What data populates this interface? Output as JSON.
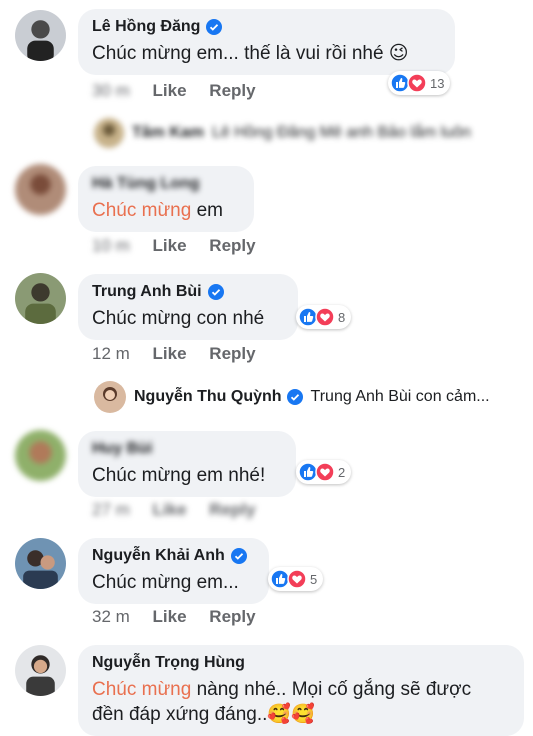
{
  "actions": {
    "like": "Like",
    "reply": "Reply"
  },
  "comments": [
    {
      "name": "Lê Hồng Đăng",
      "verified": true,
      "text": "Chúc mừng em... thế là vui rồi nhé 😉",
      "time": "",
      "reaction_count": "13"
    },
    {
      "name": "Hà Tùng Long",
      "verified": false,
      "highlight": "Chúc mừng",
      "text": " em",
      "time": "",
      "reaction_count": ""
    },
    {
      "name": "Trung Anh Bùi",
      "verified": true,
      "text": "Chúc mừng con nhé",
      "time": "12 m",
      "reaction_count": "8"
    },
    {
      "name": "Huy Bùi",
      "verified": false,
      "text": "Chúc mừng em nhé!",
      "time": "27 m",
      "reaction_count": "2"
    },
    {
      "name": "Nguyễn Khải Anh",
      "verified": true,
      "text": "Chúc mừng em...",
      "time": "32 m",
      "reaction_count": "5"
    },
    {
      "name": "Nguyễn Trọng Hùng",
      "verified": false,
      "highlight": "Chúc mừng",
      "text": " nàng nhé.. Mọi cố gắng sẽ được",
      "text2": "đền đáp xứng đáng..🥰🥰",
      "time": "",
      "reaction_count": ""
    }
  ],
  "replies": [
    {
      "name": "Tâm Kam",
      "text": "Lê Hồng Đăng  Mê anh Bảo lắm luôn"
    },
    {
      "name": "Nguyễn Thu Quỳnh",
      "verified": true,
      "text": "Trung Anh Bùi con cảm..."
    }
  ],
  "colors": {
    "bubble": "#f0f2f5",
    "highlight": "#e9704f",
    "like_blue": "#1877f2",
    "love_red": "#f33e58",
    "verified_blue": "#1877f2"
  }
}
